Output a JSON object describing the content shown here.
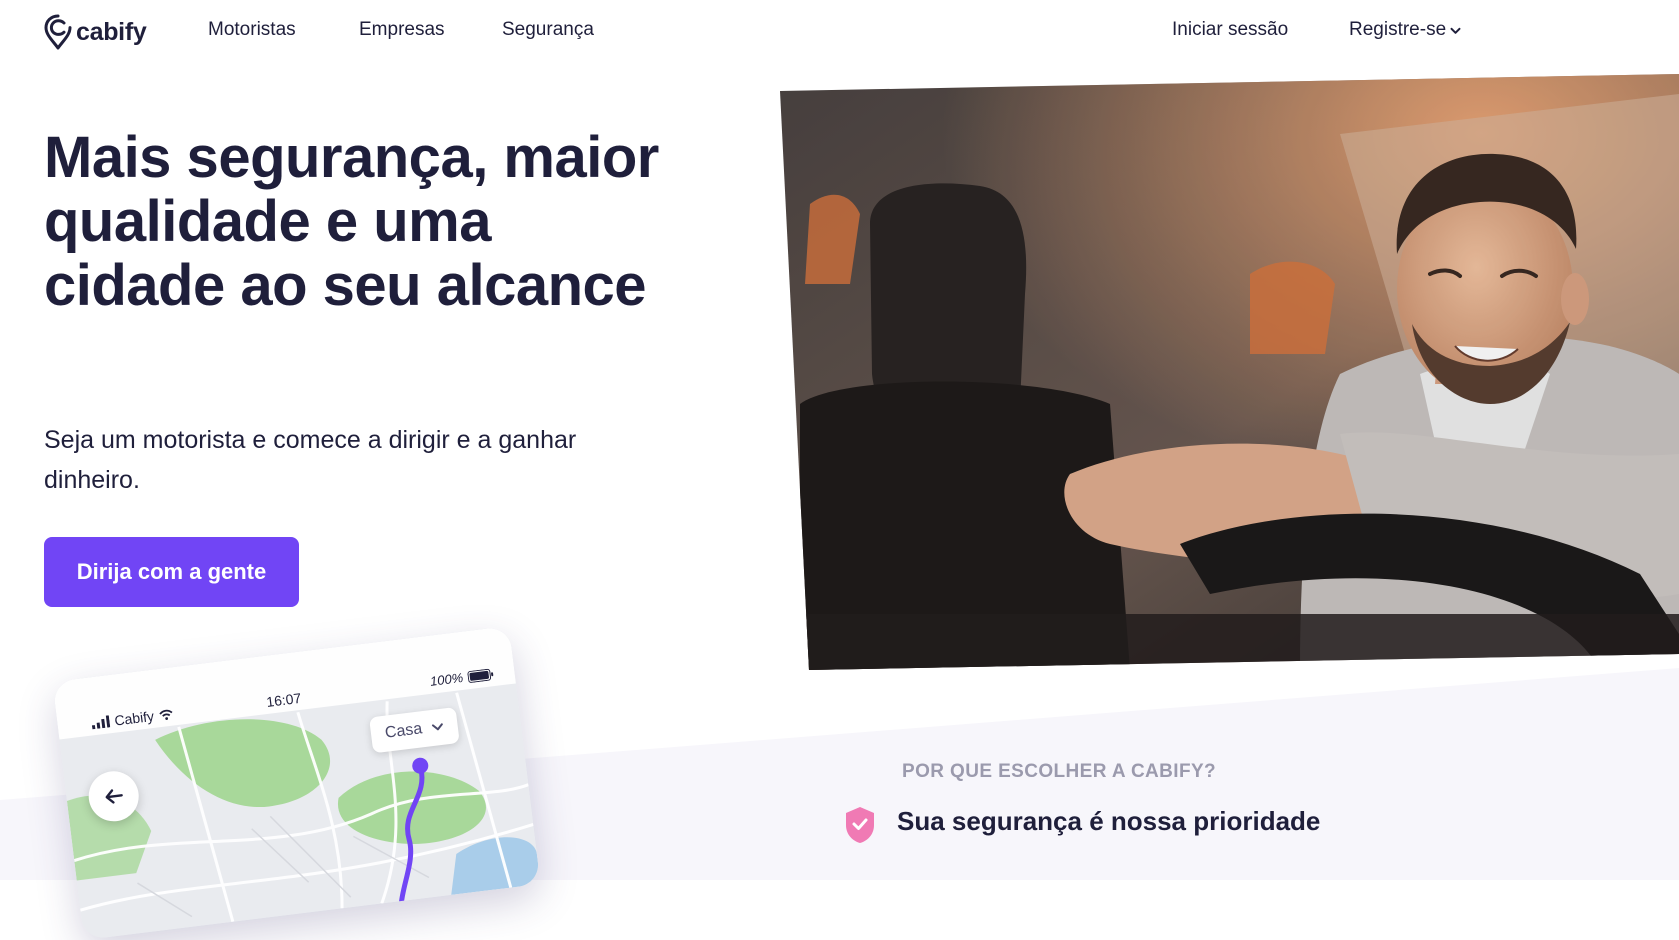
{
  "brand": {
    "name": "cabify",
    "logo_icon": "cabify-pin-logo",
    "accent_color": "#7145f5",
    "text_color": "#1f1f3b"
  },
  "nav": {
    "links": [
      {
        "label": "Motoristas"
      },
      {
        "label": "Empresas"
      },
      {
        "label": "Segurança"
      }
    ],
    "login_label": "Iniciar sessão",
    "register_label": "Registre-se",
    "register_icon": "chevron-down-icon"
  },
  "hero": {
    "title": "Mais segurança, maior qualidade e uma cidade ao seu alcance",
    "subtitle": "Seja um motorista e comece a dirigir e a ganhar dinheiro.",
    "cta_label": "Dirija com a gente",
    "photo_subject": "smiling driver at steering wheel"
  },
  "phone": {
    "carrier": "Cabify",
    "time": "16:07",
    "battery": "100%",
    "back_icon": "arrow-left-icon",
    "destination_label": "Casa",
    "destination_icon": "chevron-down-icon"
  },
  "why": {
    "label": "POR QUE ESCOLHER A CABIFY?",
    "item_title": "Sua segurança é nossa prioridade",
    "item_icon": "shield-icon",
    "item_icon_color": "#f07ab4"
  }
}
